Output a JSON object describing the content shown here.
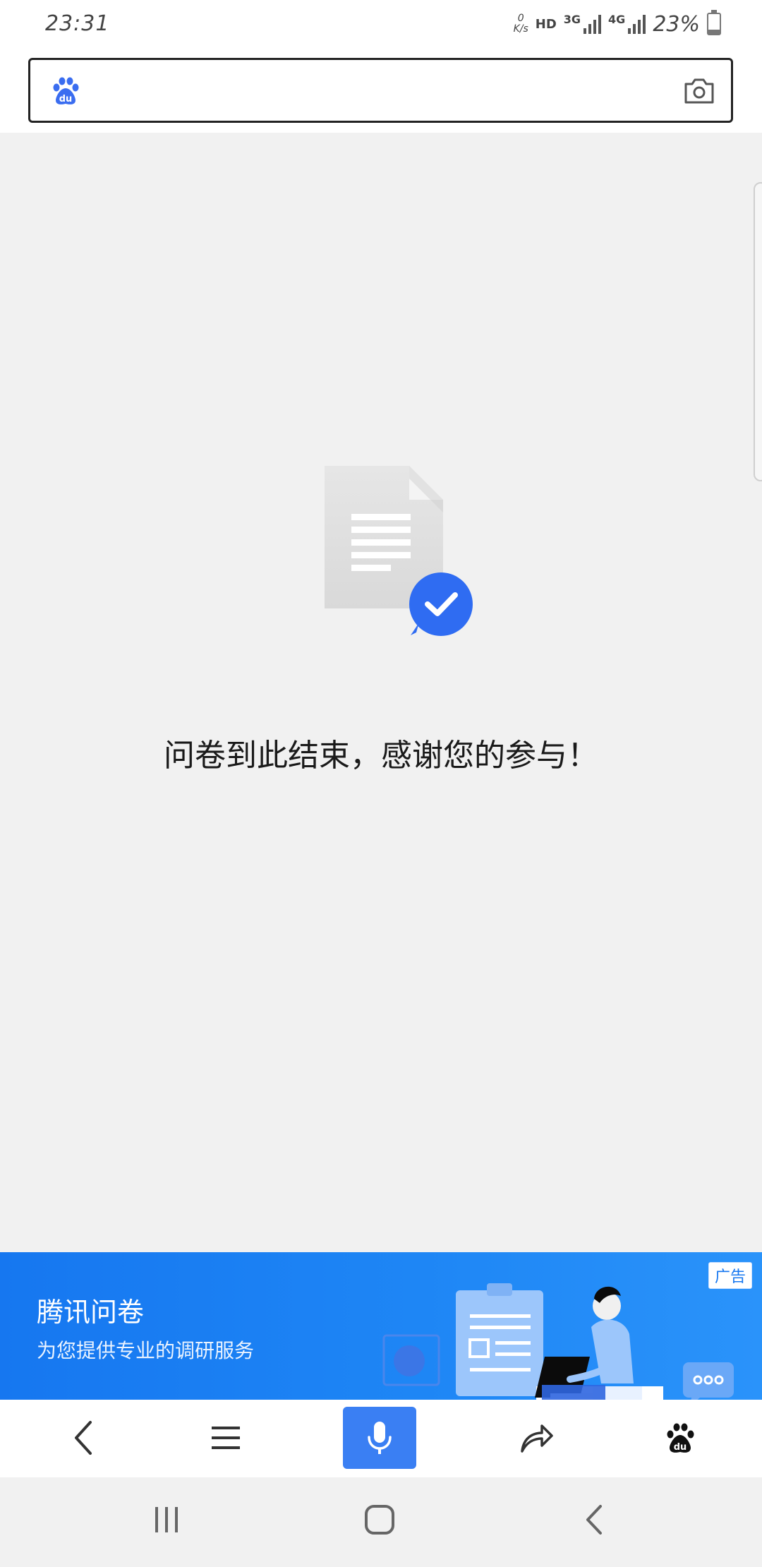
{
  "status_bar": {
    "time": "23:31",
    "net_speed_value": "0",
    "net_speed_unit": "K/s",
    "hd": "HD",
    "sim1_network": "3G",
    "sim2_network": "4G",
    "battery_percent": "23%",
    "battery_level": 0.23
  },
  "search_bar": {
    "logo_icon": "baidu-paw-icon",
    "camera_icon": "camera-icon",
    "value": ""
  },
  "main": {
    "illustration_icon": "document-check-icon",
    "message": "问卷到此结束，感谢您的参与！"
  },
  "ad": {
    "title": "腾讯问卷",
    "subtitle": "为您提供专业的调研服务",
    "tag": "广告",
    "colors": {
      "background": "#1677f0",
      "text": "#ffffff"
    }
  },
  "toolbar": {
    "items": [
      {
        "name": "back",
        "icon": "chevron-left-icon"
      },
      {
        "name": "menu",
        "icon": "menu-icon"
      },
      {
        "name": "voice",
        "icon": "microphone-icon"
      },
      {
        "name": "share",
        "icon": "share-arrow-icon"
      },
      {
        "name": "home",
        "icon": "baidu-paw-icon"
      }
    ],
    "accent_color": "#3a7ff3"
  },
  "nav_bar": {
    "items": [
      {
        "name": "recent-apps",
        "icon": "recent-apps-icon"
      },
      {
        "name": "home",
        "icon": "home-icon"
      },
      {
        "name": "back",
        "icon": "back-icon"
      }
    ]
  }
}
